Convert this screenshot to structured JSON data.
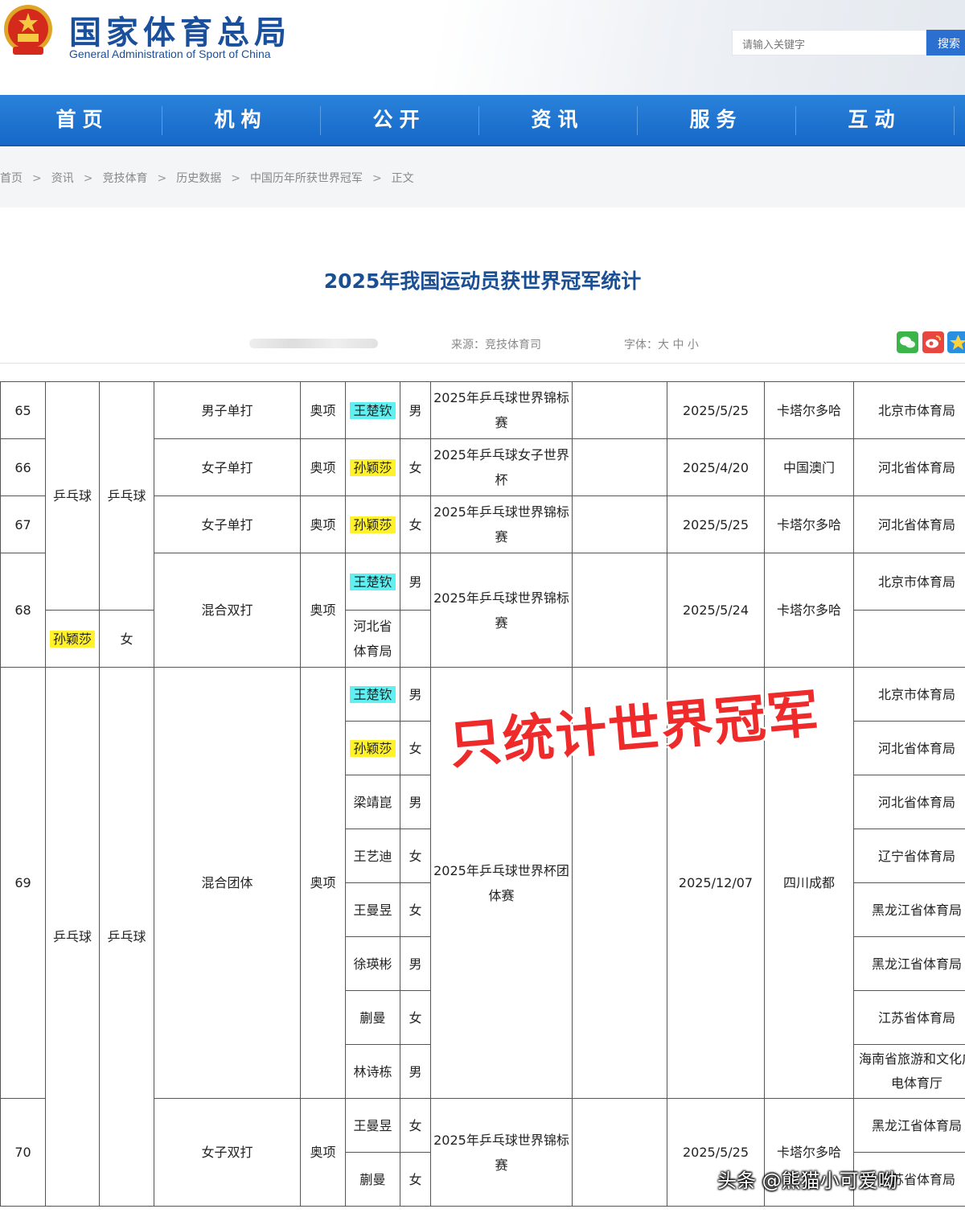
{
  "header": {
    "title": "国家体育总局",
    "subtitle": "General Administration of Sport of China",
    "search_placeholder": "请输入关键字",
    "search_button": "搜索"
  },
  "nav": [
    "首页",
    "机构",
    "公开",
    "资讯",
    "服务",
    "互动"
  ],
  "breadcrumb": [
    "首页",
    "资讯",
    "竞技体育",
    "历史数据",
    "中国历年所获世界冠军",
    "正文"
  ],
  "breadcrumb_separator": ">",
  "article": {
    "title": "2025年我国运动员获世界冠军统计",
    "source": "来源：竞技体育司",
    "font_size_label": "字体：大 中 小"
  },
  "share_icons": [
    "wechat-icon",
    "weibo-icon",
    "qzone-icon"
  ],
  "table": {
    "rows": [
      {
        "no": "65",
        "sport": "乒乓球",
        "sub": "乒乓球",
        "event": "男子单打",
        "olympic": "奥项",
        "athletes": [
          {
            "name": "王楚钦",
            "gender": "男",
            "highlight": "cyan",
            "unit": "北京市体育局"
          }
        ],
        "competition": "2025年乒乓球世界锦标赛",
        "date": "2025/5/25",
        "place": "卡塔尔多哈"
      },
      {
        "no": "66",
        "event": "女子单打",
        "olympic": "奥项",
        "athletes": [
          {
            "name": "孙颖莎",
            "gender": "女",
            "highlight": "yellow",
            "unit": "河北省体育局"
          }
        ],
        "competition": "2025年乒乓球女子世界杯",
        "date": "2025/4/20",
        "place": "中国澳门"
      },
      {
        "no": "67",
        "event": "女子单打",
        "olympic": "奥项",
        "athletes": [
          {
            "name": "孙颖莎",
            "gender": "女",
            "highlight": "yellow",
            "unit": "河北省体育局"
          }
        ],
        "competition": "2025年乒乓球世界锦标赛",
        "date": "2025/5/25",
        "place": "卡塔尔多哈"
      },
      {
        "no": "68",
        "event": "混合双打",
        "olympic": "奥项",
        "athletes": [
          {
            "name": "王楚钦",
            "gender": "男",
            "highlight": "cyan",
            "unit": "北京市体育局"
          },
          {
            "name": "孙颖莎",
            "gender": "女",
            "highlight": "yellow",
            "unit": "河北省体育局"
          }
        ],
        "competition": "2025年乒乓球世界锦标赛",
        "date": "2025/5/24",
        "place": "卡塔尔多哈"
      },
      {
        "no": "69",
        "sport": "乒乓球",
        "sub": "乒乓球",
        "event": "混合团体",
        "olympic": "奥项",
        "athletes": [
          {
            "name": "王楚钦",
            "gender": "男",
            "highlight": "cyan",
            "unit": "北京市体育局"
          },
          {
            "name": "孙颖莎",
            "gender": "女",
            "highlight": "yellow",
            "unit": "河北省体育局"
          },
          {
            "name": "梁靖崑",
            "gender": "男",
            "highlight": "",
            "unit": "河北省体育局"
          },
          {
            "name": "王艺迪",
            "gender": "女",
            "highlight": "",
            "unit": "辽宁省体育局"
          },
          {
            "name": "王曼昱",
            "gender": "女",
            "highlight": "",
            "unit": "黑龙江省体育局"
          },
          {
            "name": "徐瑛彬",
            "gender": "男",
            "highlight": "",
            "unit": "黑龙江省体育局"
          },
          {
            "name": "蒯曼",
            "gender": "女",
            "highlight": "",
            "unit": "江苏省体育局"
          },
          {
            "name": "林诗栋",
            "gender": "男",
            "highlight": "",
            "unit": "海南省旅游和文化广电体育厅"
          }
        ],
        "competition": "2025年乒乓球世界杯团体赛",
        "date": "2025/12/07",
        "place": "四川成都"
      },
      {
        "no": "70",
        "event": "女子双打",
        "olympic": "奥项",
        "athletes": [
          {
            "name": "王曼昱",
            "gender": "女",
            "highlight": "",
            "unit": "黑龙江省体育局"
          },
          {
            "name": "蒯曼",
            "gender": "女",
            "highlight": "",
            "unit": "江苏省体育局"
          }
        ],
        "competition": "2025年乒乓球世界锦标赛",
        "date": "2025/5/25",
        "place": "卡塔尔多哈"
      }
    ]
  },
  "overlay": {
    "stamp": "只统计世界冠军",
    "watermark": "头条 @熊猫小可爱呦"
  },
  "colors": {
    "nav": "#1a74d2",
    "title": "#1b4f93",
    "stamp": "#ee2a2a",
    "cyan": "#5ff0f2",
    "yellow": "#fff12a"
  }
}
